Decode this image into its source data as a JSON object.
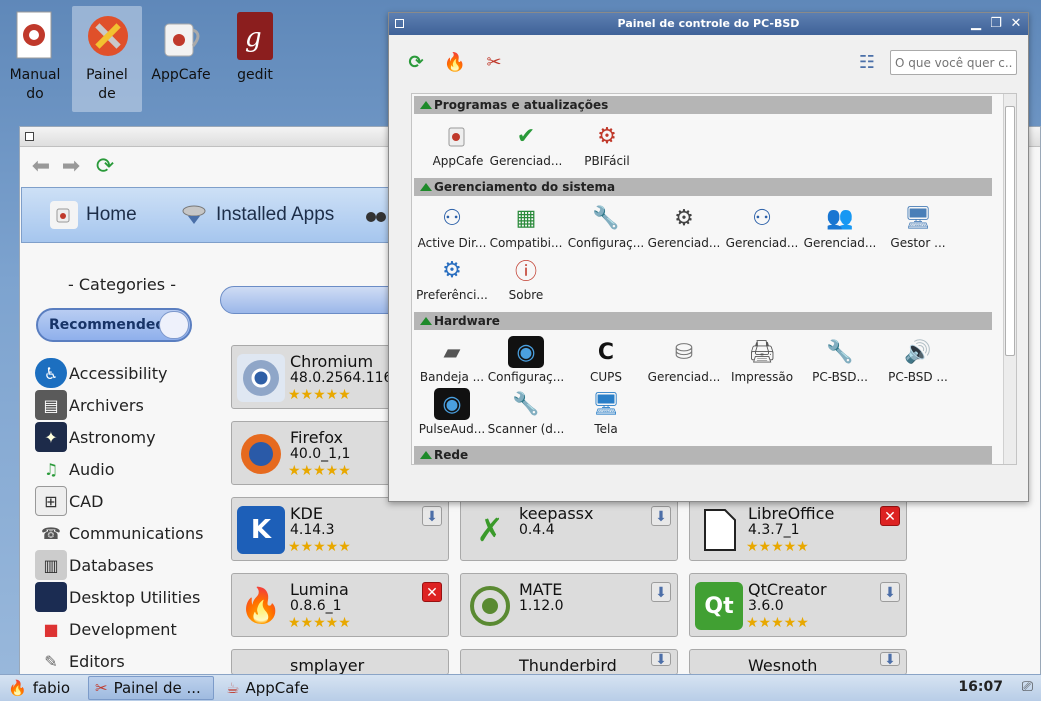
{
  "desktop": {
    "icons": [
      {
        "label_1": "Manual",
        "label_2": "do"
      },
      {
        "label_1": "Painel",
        "label_2": "de"
      },
      {
        "label_1": "AppCafe",
        "label_2": ""
      },
      {
        "label_1": "gedit",
        "label_2": ""
      }
    ]
  },
  "appcafe": {
    "tabs": {
      "home": "Home",
      "installed": "Installed Apps"
    },
    "categories_title": "- Categories -",
    "recommended": "Recommended",
    "categories": [
      "Accessibility",
      "Archivers",
      "Astronomy",
      "Audio",
      "CAD",
      "Communications",
      "Databases",
      "Desktop Utilities",
      "Development",
      "Editors"
    ],
    "apps": [
      {
        "name": "Chromium",
        "version": "48.0.2564.116",
        "stars": "★★★★★"
      },
      {
        "name": "Firefox",
        "version": "40.0_1,1",
        "stars": "★★★★★"
      },
      {
        "name": "KDE",
        "version": "4.14.3",
        "stars": "★★★★★"
      },
      {
        "name": "keepassx",
        "version": "0.4.4",
        "stars": ""
      },
      {
        "name": "LibreOffice",
        "version": "4.3.7_1",
        "stars": "★★★★★"
      },
      {
        "name": "Lumina",
        "version": "0.8.6_1",
        "stars": "★★★★★"
      },
      {
        "name": "MATE",
        "version": "1.12.0",
        "stars": ""
      },
      {
        "name": "QtCreator",
        "version": "3.6.0",
        "stars": "★★★★★"
      },
      {
        "name": "smplayer",
        "version": "",
        "stars": ""
      },
      {
        "name": "Thunderbird",
        "version": "",
        "stars": ""
      },
      {
        "name": "Wesnoth",
        "version": "",
        "stars": ""
      }
    ]
  },
  "control_panel": {
    "title": "Painel de controle do PC-BSD",
    "search_placeholder": "O que você quer c...",
    "sections": {
      "programs": "Programas e atualizações",
      "system": "Gerenciamento do sistema",
      "hardware": "Hardware",
      "network": "Rede"
    },
    "programs_items": [
      "AppCafe",
      "Gerenciad...",
      "PBIFácil"
    ],
    "system_items": [
      "Active Dir...",
      "Compatibi...",
      "Configuraç...",
      "Gerenciad...",
      "Gerenciad...",
      "Gerenciad...",
      "Gestor ...",
      "Preferênci...",
      "Sobre"
    ],
    "hardware_items": [
      "Bandeja ...",
      "Configuraç...",
      "CUPS",
      "Gerenciad...",
      "Impressão",
      "PC-BSD...",
      "PC-BSD ...",
      "PulseAud...",
      "Scanner (d...",
      "Tela"
    ]
  },
  "taskbar": {
    "user": "fabio",
    "task1": "Painel de ...",
    "task2": "AppCafe",
    "clock": "16:07"
  }
}
